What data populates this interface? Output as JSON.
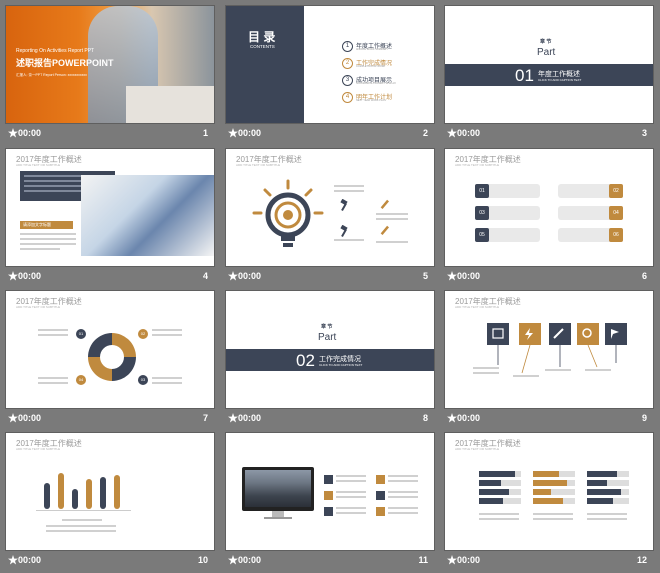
{
  "slides": [
    {
      "time": "00:00",
      "num": "1",
      "title_en": "Reporting On Activities Report PPT",
      "title_cn": "述职报告",
      "title_ppt": "POWERPOINT",
      "byline": "汇报人:  奈一PPT   Report Person: xxxxxxxxxxx"
    },
    {
      "time": "00:00",
      "num": "2",
      "heading": "目 录",
      "heading_en": "CONTENTS",
      "items": [
        {
          "n": "1",
          "label": "年度工作概述",
          "sub": "ANNUAL WORK SUMMARY"
        },
        {
          "n": "2",
          "label": "工作完成情况",
          "sub": "COMPLETION OF WORK"
        },
        {
          "n": "3",
          "label": "成功项目展示",
          "sub": "SUCCESSFUL PROJECT DISPLAY"
        },
        {
          "n": "4",
          "label": "明年工作计划",
          "sub": "NEXT YEAR WORK PLAN"
        }
      ]
    },
    {
      "time": "00:00",
      "num": "3",
      "chapter": "章 节",
      "part": "Part",
      "pnum": "01",
      "ptitle": "年度工作概述",
      "psub": "CLICK TO ADD CAPTION TEXT"
    },
    {
      "time": "00:00",
      "num": "4",
      "title": "2017年度工作概述",
      "sub": "ADD TITLE TEXT OR SUBTITLE",
      "box": "请添加文字标题"
    },
    {
      "time": "00:00",
      "num": "5",
      "title": "2017年度工作概述",
      "sub": "ADD TITLE TEXT OR SUBTITLE"
    },
    {
      "time": "00:00",
      "num": "6",
      "title": "2017年度工作概述",
      "sub": "ADD TITLE TEXT OR SUBTITLE",
      "badges": [
        "01",
        "02",
        "03",
        "04",
        "05",
        "06"
      ]
    },
    {
      "time": "00:00",
      "num": "7",
      "title": "2017年度工作概述",
      "sub": "ADD TITLE TEXT OR SUBTITLE",
      "badges": [
        "01",
        "02",
        "03",
        "04"
      ]
    },
    {
      "time": "00:00",
      "num": "8",
      "chapter": "章 节",
      "part": "Part",
      "pnum": "02",
      "ptitle": "工作完成情况",
      "psub": "CLICK TO ADD CAPTION TEXT"
    },
    {
      "time": "00:00",
      "num": "9",
      "title": "2017年度工作概述",
      "sub": "ADD TITLE TEXT OR SUBTITLE"
    },
    {
      "time": "00:00",
      "num": "10",
      "title": "2017年度工作概述",
      "sub": "ADD TITLE TEXT OR SUBTITLE"
    },
    {
      "time": "00:00",
      "num": "11"
    },
    {
      "time": "00:00",
      "num": "12",
      "title": "2017年度工作概述",
      "sub": "ADD TITLE TEXT OR SUBTITLE"
    }
  ],
  "colors": {
    "navy": "#3c4557",
    "gold": "#c08a3e",
    "bg": "#7a7a7a"
  }
}
